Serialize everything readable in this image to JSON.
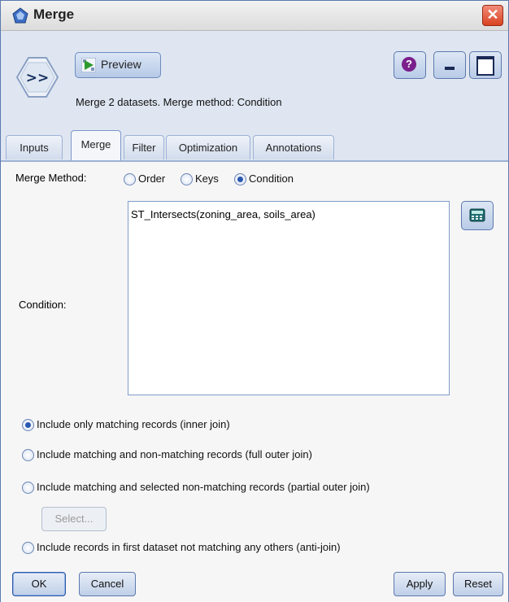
{
  "window": {
    "title": "Merge",
    "close_glyph": "✕"
  },
  "toolbar": {
    "preview_label": "Preview",
    "help_glyph": "?",
    "description": "Merge 2 datasets. Merge method: Condition"
  },
  "tabs": [
    {
      "label": "Inputs",
      "active": false
    },
    {
      "label": "Merge",
      "active": true
    },
    {
      "label": "Filter",
      "active": false
    },
    {
      "label": "Optimization",
      "active": false
    },
    {
      "label": "Annotations",
      "active": false
    }
  ],
  "merge_method": {
    "label": "Merge Method:",
    "options": [
      "Order",
      "Keys",
      "Condition"
    ],
    "selected": "Condition"
  },
  "condition": {
    "label": "Condition:",
    "value": "ST_Intersects(zoning_area, soils_area)"
  },
  "join_options": [
    {
      "label": "Include only matching records (inner join)",
      "selected": true
    },
    {
      "label": "Include matching and non-matching records (full outer join)",
      "selected": false
    },
    {
      "label": "Include matching and selected non-matching records (partial outer join)",
      "selected": false
    },
    {
      "label": "Include records in first dataset not matching any others (anti-join)",
      "selected": false
    }
  ],
  "select_button": {
    "label": "Select...",
    "enabled": false
  },
  "footer": {
    "ok": "OK",
    "cancel": "Cancel",
    "apply": "Apply",
    "reset": "Reset"
  },
  "colors": {
    "accent": "#2a58b0",
    "header_bg": "#dfe6f1",
    "close_red": "#d9421f"
  }
}
